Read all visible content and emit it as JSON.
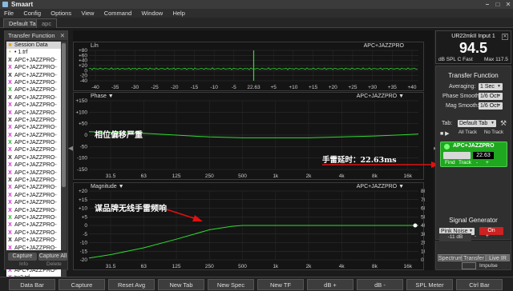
{
  "app": {
    "title": "Smaart"
  },
  "menu": [
    "File",
    "Config",
    "Options",
    "View",
    "Command",
    "Window",
    "Help"
  ],
  "tabs": [
    {
      "label": "Default Tab"
    },
    {
      "label": "apc"
    }
  ],
  "left": {
    "title": "Transfer Function",
    "session_label": "Session Data",
    "files": [
      "• 1.trf",
      "APC+JAZZPRO-",
      "APC+JAZZPRO-",
      "APC+JAZZPRO-",
      "APC+JAZZPRO-",
      "APC+JAZZPRO-",
      "APC+JAZZPRO-",
      "APC+JAZZPRO-",
      "APC+JAZZPRO-",
      "APC+JAZZPRO-",
      "APC+JAZZPRO-",
      "APC+JAZZPRO-",
      "APC+JAZZPRO-",
      "APC+JAZZPRO-",
      "APC+JAZZPRO-",
      "APC+JAZZPRO-",
      "APC+JAZZPRO-",
      "APC+JAZZPRO-",
      "APC+JAZZPRO-",
      "APC+JAZZPRO-",
      "APC+JAZZPRO-",
      "APC+JAZZPRO-",
      "APC+JAZZPRO-",
      "APC+JAZZPRO-",
      "APC+JAZZPRO-",
      "APC+JAZZPRO-",
      "APC+JAZZPRO-",
      "APC+JAZZPRO-",
      "APC+JAZZPRO-",
      "APC+JAZZPRO-",
      "tw2.trf"
    ],
    "file_icons": [
      "orange",
      "black",
      "X",
      "X",
      "X",
      "X",
      "X",
      "X",
      "X",
      "X",
      "X",
      "X",
      "X",
      "X",
      "X",
      "X",
      "X",
      "X",
      "X",
      "X",
      "X",
      "X",
      "X",
      "X",
      "X",
      "X",
      "X",
      "X",
      "X",
      "X",
      "X"
    ],
    "file_icon_colors": [
      "#e8a020",
      "#333",
      "#c2c",
      "#222",
      "#c2c",
      "#2a2",
      "#222",
      "#c2c",
      "#c2c",
      "#222",
      "#c2c",
      "#c2c",
      "#2a2",
      "#c2c",
      "#222",
      "#c2c",
      "#c2c",
      "#222",
      "#c2c",
      "#c2c",
      "#c2c",
      "#c2c",
      "#2a2",
      "#c2c",
      "#c2c",
      "#222",
      "#c2c",
      "#c2c",
      "#222",
      "#c2c",
      "#c2c"
    ],
    "capture": "Capture",
    "capture_all": "Capture All",
    "info": "Info",
    "delete": "Delete"
  },
  "plots": {
    "live": {
      "label": "L/n",
      "name": "APC+JAZZPRO",
      "yticks": [
        "+80",
        "+60",
        "+40",
        "+20",
        "0",
        "-20",
        "-40"
      ],
      "xticks": [
        "-40",
        "-35",
        "-30",
        "-25",
        "-20",
        "-15",
        "-10",
        "-5",
        "22.63",
        "+5",
        "+10",
        "+15",
        "+20",
        "+25",
        "+30",
        "+35",
        "+40"
      ]
    },
    "phase": {
      "label": "Phase ▼",
      "name": "APC+JAZZPRO ▼",
      "yticks": [
        "+150",
        "+100",
        "+50",
        "0",
        "-50",
        "-100",
        "-150"
      ],
      "xticks": [
        "31.5",
        "63",
        "125",
        "250",
        "500",
        "1k",
        "2k",
        "4k",
        "8k",
        "16k"
      ]
    },
    "magnitude": {
      "label": "Magnitude ▼",
      "name": "APC+JAZZPRO ▼",
      "yticks": [
        "+20",
        "+15",
        "+10",
        "+5",
        "0",
        "-5",
        "-10",
        "-15",
        "-20"
      ],
      "yticks_right": [
        "80",
        "70",
        "60",
        "50",
        "40",
        "30",
        "20",
        "10",
        "0"
      ],
      "xticks": [
        "31.5",
        "63",
        "125",
        "250",
        "500",
        "1k",
        "2k",
        "4k",
        "8k",
        "16k"
      ]
    },
    "phase_data": {
      "x_hz": [
        20,
        31.5,
        63,
        125,
        250,
        500,
        1000,
        2000,
        4000,
        8000,
        16000,
        20000
      ],
      "phase_deg": [
        15,
        12,
        8,
        0,
        -8,
        -12,
        -12,
        -12,
        -8,
        -4,
        2,
        5
      ]
    },
    "mag_data": {
      "x_hz": [
        20,
        31.5,
        63,
        125,
        250,
        400,
        500,
        1000,
        2000,
        4000,
        8000,
        16000,
        20000
      ],
      "mag_db": [
        -19,
        -17,
        -13,
        -8,
        -2.5,
        -0.5,
        0,
        0,
        0,
        0,
        0,
        0,
        0
      ]
    }
  },
  "annotations": {
    "phase_note": "相位偏移严重",
    "delay_note": "手雷延时：22.63ms",
    "mag_note": "谋品牌无线手雷频响"
  },
  "right": {
    "meter": {
      "device": "UR22mkII Input 1",
      "value": "94.5",
      "unit": "dB SPL C Fast",
      "max": "Max 117.5"
    },
    "tf": {
      "title": "Transfer Function",
      "averaging_label": "Averaging:",
      "averaging_value": "1 Sec",
      "phase_smooth_label": "Phase Smooth:",
      "phase_smooth_value": "1/6 Oct",
      "mag_smooth_label": "Mag Smooth:",
      "mag_smooth_value": "1/6 Oct",
      "tab_label": "Tab:",
      "tab_value": "Default Tab",
      "all_track": "All Track",
      "no_track": "No Track",
      "measurement": "APC+JAZZPRO",
      "delay_value": "22.63",
      "find": "Find",
      "track": "Track"
    },
    "gen": {
      "title": "Signal Generator",
      "type": "Pink Noise",
      "state": "On",
      "level": "-11 dB"
    },
    "modes": [
      "Spectrum",
      "Transfer",
      "Live IR"
    ],
    "impulse": "Impulse"
  },
  "toolbar": [
    "Data Bar",
    "Capture",
    "Reset Avg",
    "New Tab",
    "New Spec",
    "New TF",
    "dB +",
    "dB -",
    "SPL Meter",
    "Ctrl Bar"
  ],
  "colors": {
    "trace": "#2fdc2f",
    "delay_green": "#1fa81f",
    "arrow": "#e01010",
    "on_red": "#c22",
    "display_green": "#49e04a"
  }
}
